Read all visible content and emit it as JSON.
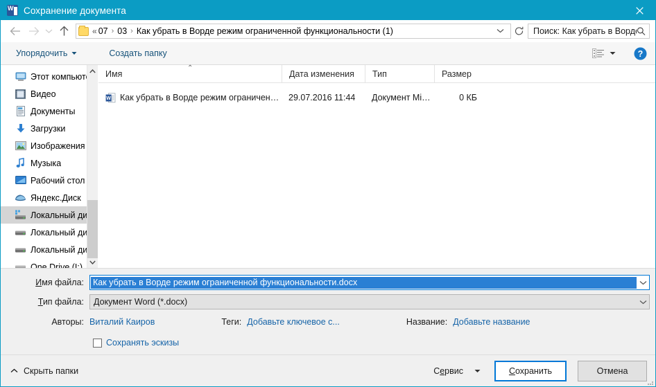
{
  "window": {
    "title": "Сохранение документа",
    "app_icon": "word-icon",
    "close_label": "×",
    "title_bar_color": "#0b9cc4",
    "accent_color": "#0078d7"
  },
  "nav": {
    "back_icon": "arrow-left-icon",
    "forward_icon": "arrow-right-icon",
    "history_icon": "chevron-down-icon",
    "up_icon": "arrow-up-icon",
    "refresh_icon": "refresh-icon",
    "address_caret_icon": "chevron-down-icon"
  },
  "address": {
    "folder_icon": "folder-icon",
    "prefix": "«",
    "crumbs": [
      "07",
      "03",
      "Как убрать в Ворде режим ограниченной функциональности (1)"
    ],
    "separator": "›"
  },
  "search": {
    "placeholder": "Поиск: Как убрать в Ворде р...",
    "value": "",
    "icon": "search-icon"
  },
  "toolbar": {
    "organize_label": "Упорядочить",
    "new_folder_label": "Создать папку",
    "view_icon": "view-list-icon",
    "view_caret_icon": "chevron-down-icon",
    "help_icon": "help-circle-icon",
    "help_label": "?"
  },
  "sidebar": {
    "items": [
      {
        "label": "Этот компьютер",
        "icon": "computer-icon",
        "selected": false
      },
      {
        "label": "Видео",
        "icon": "video-icon",
        "selected": false
      },
      {
        "label": "Документы",
        "icon": "documents-icon",
        "selected": false
      },
      {
        "label": "Загрузки",
        "icon": "downloads-icon",
        "selected": false
      },
      {
        "label": "Изображения",
        "icon": "pictures-icon",
        "selected": false
      },
      {
        "label": "Музыка",
        "icon": "music-icon",
        "selected": false
      },
      {
        "label": "Рабочий стол",
        "icon": "desktop-icon",
        "selected": false
      },
      {
        "label": "Яндекс.Диск",
        "icon": "yandex-disk-icon",
        "selected": false
      },
      {
        "label": "Локальный дис",
        "icon": "local-disk-system-icon",
        "selected": true
      },
      {
        "label": "Локальный дис",
        "icon": "local-disk-icon",
        "selected": false
      },
      {
        "label": "Локальный дис",
        "icon": "local-disk-icon",
        "selected": false
      },
      {
        "label": "One Drive (I:)",
        "icon": "local-disk-icon",
        "selected": false
      }
    ],
    "scroll_up_icon": "chevron-up-icon",
    "scroll_down_icon": "chevron-down-icon"
  },
  "filelist": {
    "columns": [
      {
        "label": "Имя",
        "sorted": true
      },
      {
        "label": "Дата изменения",
        "sorted": false
      },
      {
        "label": "Тип",
        "sorted": false
      },
      {
        "label": "Размер",
        "sorted": false
      }
    ],
    "sort_marker": "⌃",
    "rows": [
      {
        "icon": "word-document-icon",
        "name": "Как убрать в Ворде режим ограниченн...",
        "date": "29.07.2016 11:44",
        "type": "Документ Micros...",
        "size": "0 КБ"
      }
    ]
  },
  "form": {
    "filename_label_pre": "",
    "filename_label_accel": "И",
    "filename_label_post": "мя файла:",
    "filename_value": "Как убрать в Ворде режим ограниченной функциональности.docx",
    "filetype_label_accel": "Т",
    "filetype_label_post": "ип файла:",
    "filetype_value": "Документ Word (*.docx)",
    "combo_caret_icon": "chevron-down-icon"
  },
  "metadata": {
    "authors_label": "Авторы:",
    "authors_value": "Виталий Каиров",
    "tags_label": "Теги:",
    "tags_value": "Добавьте ключевое с...",
    "title_label": "Название:",
    "title_value": "Добавьте название",
    "thumbnails_label": "Сохранять эскизы",
    "thumbnails_checked": false
  },
  "footer": {
    "hide_folders_label": "Скрыть папки",
    "hide_folders_icon": "chevron-up-icon",
    "tools_label_pre": "С",
    "tools_label_accel": "е",
    "tools_label_post": "рвис",
    "tools_caret_icon": "chevron-down-icon",
    "save_label_accel": "С",
    "save_label_post": "охранить",
    "save_label": "Сохранить",
    "cancel_label": "Отмена",
    "resize_grip_icon": "resize-grip-icon"
  }
}
